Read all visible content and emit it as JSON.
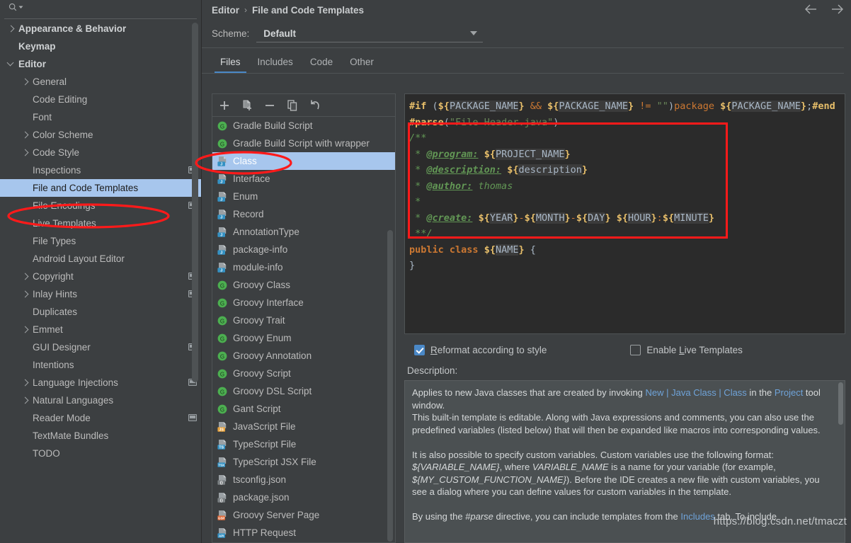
{
  "sidebar": {
    "search": {
      "placeholder": "",
      "icon": "search-icon"
    },
    "items": [
      {
        "label": "Appearance & Behavior",
        "indent": 0,
        "arrow": "right",
        "bold": true,
        "badge": false,
        "selected": false
      },
      {
        "label": "Keymap",
        "indent": 0,
        "arrow": "none",
        "bold": true,
        "badge": false,
        "selected": false
      },
      {
        "label": "Editor",
        "indent": 0,
        "arrow": "down",
        "bold": true,
        "badge": false,
        "selected": false
      },
      {
        "label": "General",
        "indent": 1,
        "arrow": "right",
        "bold": false,
        "badge": false,
        "selected": false
      },
      {
        "label": "Code Editing",
        "indent": 1,
        "arrow": "none",
        "bold": false,
        "badge": false,
        "selected": false
      },
      {
        "label": "Font",
        "indent": 1,
        "arrow": "none",
        "bold": false,
        "badge": false,
        "selected": false
      },
      {
        "label": "Color Scheme",
        "indent": 1,
        "arrow": "right",
        "bold": false,
        "badge": false,
        "selected": false
      },
      {
        "label": "Code Style",
        "indent": 1,
        "arrow": "right",
        "bold": false,
        "badge": false,
        "selected": false
      },
      {
        "label": "Inspections",
        "indent": 1,
        "arrow": "none",
        "bold": false,
        "badge": true,
        "selected": false
      },
      {
        "label": "File and Code Templates",
        "indent": 1,
        "arrow": "none",
        "bold": false,
        "badge": false,
        "selected": true
      },
      {
        "label": "File Encodings",
        "indent": 1,
        "arrow": "none",
        "bold": false,
        "badge": true,
        "selected": false
      },
      {
        "label": "Live Templates",
        "indent": 1,
        "arrow": "none",
        "bold": false,
        "badge": false,
        "selected": false
      },
      {
        "label": "File Types",
        "indent": 1,
        "arrow": "none",
        "bold": false,
        "badge": false,
        "selected": false
      },
      {
        "label": "Android Layout Editor",
        "indent": 1,
        "arrow": "none",
        "bold": false,
        "badge": false,
        "selected": false
      },
      {
        "label": "Copyright",
        "indent": 1,
        "arrow": "right",
        "bold": false,
        "badge": true,
        "selected": false
      },
      {
        "label": "Inlay Hints",
        "indent": 1,
        "arrow": "right",
        "bold": false,
        "badge": true,
        "selected": false
      },
      {
        "label": "Duplicates",
        "indent": 1,
        "arrow": "none",
        "bold": false,
        "badge": false,
        "selected": false
      },
      {
        "label": "Emmet",
        "indent": 1,
        "arrow": "right",
        "bold": false,
        "badge": false,
        "selected": false
      },
      {
        "label": "GUI Designer",
        "indent": 1,
        "arrow": "none",
        "bold": false,
        "badge": true,
        "selected": false
      },
      {
        "label": "Intentions",
        "indent": 1,
        "arrow": "none",
        "bold": false,
        "badge": false,
        "selected": false
      },
      {
        "label": "Language Injections",
        "indent": 1,
        "arrow": "right",
        "bold": false,
        "badge": true,
        "selected": false
      },
      {
        "label": "Natural Languages",
        "indent": 1,
        "arrow": "right",
        "bold": false,
        "badge": false,
        "selected": false
      },
      {
        "label": "Reader Mode",
        "indent": 1,
        "arrow": "none",
        "bold": false,
        "badge": true,
        "selected": false
      },
      {
        "label": "TextMate Bundles",
        "indent": 1,
        "arrow": "none",
        "bold": false,
        "badge": false,
        "selected": false
      },
      {
        "label": "TODO",
        "indent": 1,
        "arrow": "none",
        "bold": false,
        "badge": false,
        "selected": false
      }
    ]
  },
  "header": {
    "breadcrumb": {
      "parent": "Editor",
      "separator": "›",
      "current": "File and Code Templates"
    },
    "back_icon": "arrow-left-icon",
    "forward_icon": "arrow-right-icon"
  },
  "scheme": {
    "label": "Scheme:",
    "value": "Default",
    "caret_icon": "chevron-down-icon"
  },
  "tabs": [
    {
      "label": "Files",
      "active": true
    },
    {
      "label": "Includes",
      "active": false
    },
    {
      "label": "Code",
      "active": false
    },
    {
      "label": "Other",
      "active": false
    }
  ],
  "filelist": {
    "toolbar": [
      {
        "name": "add-template-button",
        "icon": "plus-icon"
      },
      {
        "name": "create-child-template-button",
        "icon": "file-add-icon"
      },
      {
        "name": "remove-template-button",
        "icon": "minus-icon"
      },
      {
        "name": "copy-template-button",
        "icon": "copy-icon"
      },
      {
        "name": "reset-template-button",
        "icon": "undo-icon"
      }
    ],
    "items": [
      {
        "label": "Gradle Build Script",
        "icon": "groovy-icon",
        "selected": false
      },
      {
        "label": "Gradle Build Script with wrapper",
        "icon": "groovy-icon",
        "selected": false
      },
      {
        "label": "Class",
        "icon": "java-class-icon",
        "selected": true
      },
      {
        "label": "Interface",
        "icon": "java-class-icon",
        "selected": false
      },
      {
        "label": "Enum",
        "icon": "java-class-icon",
        "selected": false
      },
      {
        "label": "Record",
        "icon": "java-class-icon",
        "selected": false
      },
      {
        "label": "AnnotationType",
        "icon": "java-class-icon",
        "selected": false
      },
      {
        "label": "package-info",
        "icon": "java-class-icon",
        "selected": false
      },
      {
        "label": "module-info",
        "icon": "java-class-icon",
        "selected": false
      },
      {
        "label": "Groovy Class",
        "icon": "groovy-icon",
        "selected": false
      },
      {
        "label": "Groovy Interface",
        "icon": "groovy-icon",
        "selected": false
      },
      {
        "label": "Groovy Trait",
        "icon": "groovy-icon",
        "selected": false
      },
      {
        "label": "Groovy Enum",
        "icon": "groovy-icon",
        "selected": false
      },
      {
        "label": "Groovy Annotation",
        "icon": "groovy-icon",
        "selected": false
      },
      {
        "label": "Groovy Script",
        "icon": "groovy-icon",
        "selected": false
      },
      {
        "label": "Groovy DSL Script",
        "icon": "groovy-icon",
        "selected": false
      },
      {
        "label": "Gant Script",
        "icon": "groovy-icon",
        "selected": false
      },
      {
        "label": "JavaScript File",
        "icon": "js-file-icon",
        "selected": false
      },
      {
        "label": "TypeScript File",
        "icon": "ts-file-icon",
        "selected": false
      },
      {
        "label": "TypeScript JSX File",
        "icon": "tsx-file-icon",
        "selected": false
      },
      {
        "label": "tsconfig.json",
        "icon": "json-file-icon",
        "selected": false
      },
      {
        "label": "package.json",
        "icon": "json-file-icon",
        "selected": false
      },
      {
        "label": "Groovy Server Page",
        "icon": "gsp-file-icon",
        "selected": false
      },
      {
        "label": "HTTP Request",
        "icon": "api-file-icon",
        "selected": false
      }
    ]
  },
  "editor": {
    "lines": [
      "#if (${PACKAGE_NAME} && ${PACKAGE_NAME} != \"\")package ${PACKAGE_NAME};#end",
      "#parse(\"File Header.java\")",
      "/**",
      " * @program: ${PROJECT_NAME}",
      " * @description: ${description}",
      " * @author: thomas",
      " *",
      " * @create: ${YEAR}-${MONTH}-${DAY} ${HOUR}:${MINUTE}",
      " **/",
      "public class ${NAME} {",
      "}"
    ],
    "author_value": "thomas",
    "program_tag": "@program:",
    "description_tag": "@description:",
    "author_tag": "@author:",
    "create_tag": "@create:"
  },
  "options": {
    "reformat": {
      "label": "Reformat according to style",
      "underline": "R",
      "checked": true
    },
    "live_templates": {
      "label": "Enable Live Templates",
      "underline": "L",
      "checked": false
    }
  },
  "description": {
    "label": "Description:",
    "p1_a": "Applies to new Java classes that are created by invoking ",
    "p1_link1": "New | Java Class | Class",
    "p1_b": " in the ",
    "p1_link2": "Project",
    "p1_c": " tool window.",
    "p2": "This built-in template is editable. Along with Java expressions and comments, you can also use the predefined variables (listed below) that will then be expanded like macros into corresponding values.",
    "p3_a": "It is also possible to specify custom variables. Custom variables use the following format: ",
    "p3_v1": "${VARIABLE_NAME}",
    "p3_b": ", where ",
    "p3_v2": "VARIABLE_NAME",
    "p3_c": " is a name for your variable (for example, ",
    "p3_v3": "${MY_CUSTOM_FUNCTION_NAME}",
    "p3_d": "). Before the IDE creates a new file with custom variables, you see a dialog where you can define values for custom variables in the template.",
    "p4_a": "By using the ",
    "p4_v1": "#parse",
    "p4_b": " directive, you can include templates from the ",
    "p4_link": "Includes",
    "p4_c": " tab. To include"
  },
  "annotations": {
    "ellipse_sidebar": "highlight-file-and-code-templates",
    "ellipse_class": "highlight-class-template",
    "red_box": "highlight-javadoc-header",
    "color": "#ff1a1a"
  },
  "watermark": "https://blog.csdn.net/tmaczt"
}
